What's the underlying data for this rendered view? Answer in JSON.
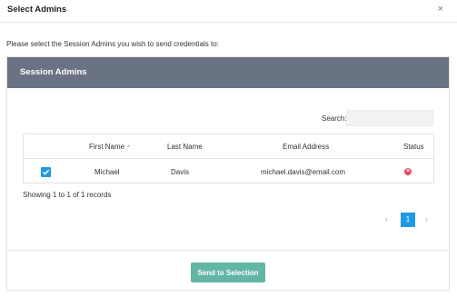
{
  "dialog": {
    "title": "Select Admins",
    "close_glyph": "×",
    "instruction": "Please select the Session Admins you wish to send credentials to:"
  },
  "panel": {
    "title": "Session Admins",
    "search_label": "Search:",
    "search_value": ""
  },
  "table": {
    "columns": [
      "First Name",
      "Last Name",
      "Email Address",
      "Status"
    ],
    "sort_glyph": "^",
    "rows": [
      {
        "checked": true,
        "first_name": "Michael",
        "last_name": "Davis",
        "email": "michael.davis@email.com",
        "status": "inactive",
        "status_glyph": "×"
      }
    ]
  },
  "footer": {
    "showing": "Showing 1 to 1 of 1 records",
    "prev_glyph": "‹",
    "current_page": "1",
    "next_glyph": "›"
  },
  "actions": {
    "send_label": "Send to Selection"
  },
  "colors": {
    "panel_header": "#6a7384",
    "accent_blue": "#1f9ae0",
    "send_button": "#63b6a3",
    "status_error": "#e84a5f"
  }
}
